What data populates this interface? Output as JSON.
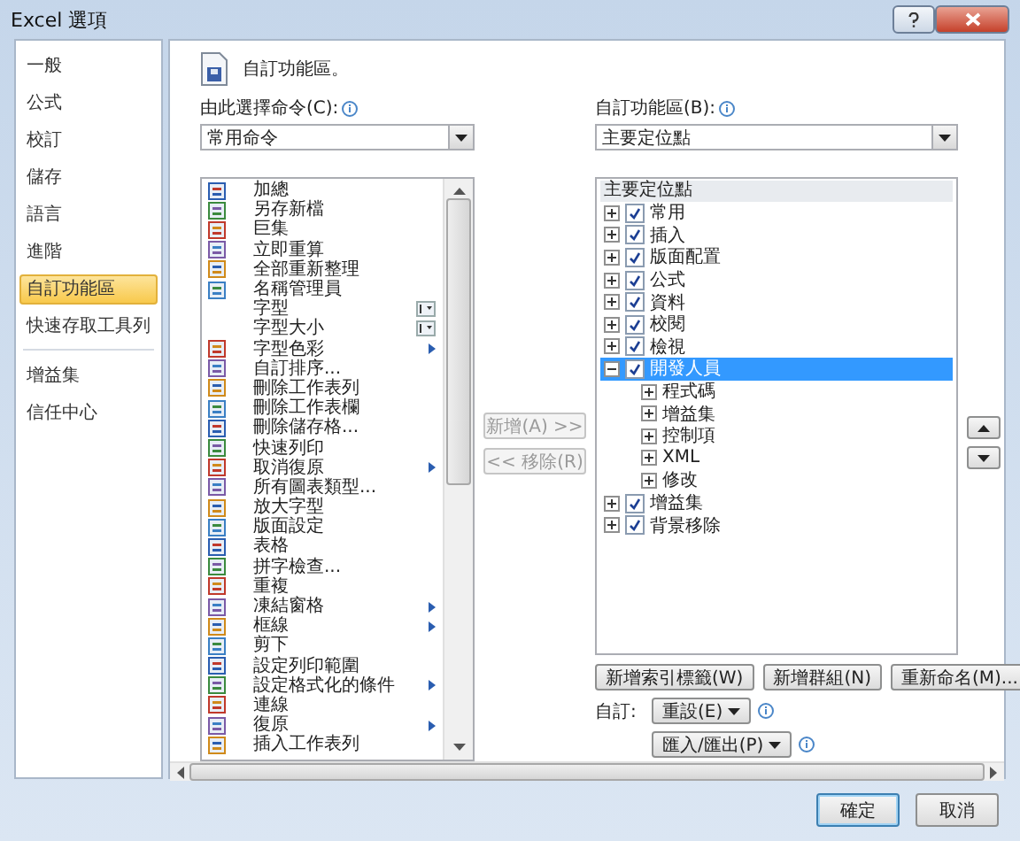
{
  "window": {
    "title": "Excel 選項"
  },
  "sidebar": {
    "groups": [
      {
        "items": [
          {
            "label": "一般",
            "selected": false
          },
          {
            "label": "公式",
            "selected": false
          },
          {
            "label": "校訂",
            "selected": false
          },
          {
            "label": "儲存",
            "selected": false
          },
          {
            "label": "語言",
            "selected": false
          },
          {
            "label": "進階",
            "selected": false
          },
          {
            "label": "自訂功能區",
            "selected": true
          },
          {
            "label": "快速存取工具列",
            "selected": false
          }
        ]
      },
      {
        "items": [
          {
            "label": "增益集",
            "selected": false
          },
          {
            "label": "信任中心",
            "selected": false
          }
        ]
      }
    ]
  },
  "header": {
    "title": "自訂功能區。"
  },
  "commands": {
    "label": "由此選擇命令(C):",
    "dropdown": "常用命令",
    "items": [
      {
        "label": "加總",
        "kind": "plain"
      },
      {
        "label": "另存新檔",
        "kind": "plain"
      },
      {
        "label": "巨集",
        "kind": "plain"
      },
      {
        "label": "立即重算",
        "kind": "plain"
      },
      {
        "label": "全部重新整理",
        "kind": "plain"
      },
      {
        "label": "名稱管理員",
        "kind": "plain"
      },
      {
        "label": "字型",
        "kind": "combo"
      },
      {
        "label": "字型大小",
        "kind": "combo"
      },
      {
        "label": "字型色彩",
        "kind": "submenu"
      },
      {
        "label": "自訂排序...",
        "kind": "plain"
      },
      {
        "label": "刪除工作表列",
        "kind": "plain"
      },
      {
        "label": "刪除工作表欄",
        "kind": "plain"
      },
      {
        "label": "刪除儲存格...",
        "kind": "plain"
      },
      {
        "label": "快速列印",
        "kind": "plain"
      },
      {
        "label": "取消復原",
        "kind": "submenu"
      },
      {
        "label": "所有圖表類型...",
        "kind": "plain"
      },
      {
        "label": "放大字型",
        "kind": "plain"
      },
      {
        "label": "版面設定",
        "kind": "plain"
      },
      {
        "label": "表格",
        "kind": "plain"
      },
      {
        "label": "拼字檢查...",
        "kind": "plain"
      },
      {
        "label": "重複",
        "kind": "plain"
      },
      {
        "label": "凍結窗格",
        "kind": "submenu"
      },
      {
        "label": "框線",
        "kind": "submenu"
      },
      {
        "label": "剪下",
        "kind": "plain"
      },
      {
        "label": "設定列印範圍",
        "kind": "plain"
      },
      {
        "label": "設定格式化的條件",
        "kind": "submenu"
      },
      {
        "label": "連線",
        "kind": "plain"
      },
      {
        "label": "復原",
        "kind": "submenu"
      },
      {
        "label": "插入工作表列",
        "kind": "plain"
      }
    ]
  },
  "transfer_buttons": [
    {
      "label": "新增(A) >>",
      "disabled": true
    },
    {
      "label": "<< 移除(R)",
      "disabled": true
    }
  ],
  "ribbon": {
    "label": "自訂功能區(B):",
    "dropdown": "主要定位點",
    "tree": {
      "header": "主要定位點",
      "items": [
        {
          "label": "常用",
          "checked": true,
          "expanded": false,
          "selected": false
        },
        {
          "label": "插入",
          "checked": true,
          "expanded": false,
          "selected": false
        },
        {
          "label": "版面配置",
          "checked": true,
          "expanded": false,
          "selected": false
        },
        {
          "label": "公式",
          "checked": true,
          "expanded": false,
          "selected": false
        },
        {
          "label": "資料",
          "checked": true,
          "expanded": false,
          "selected": false
        },
        {
          "label": "校閱",
          "checked": true,
          "expanded": false,
          "selected": false
        },
        {
          "label": "檢視",
          "checked": true,
          "expanded": false,
          "selected": false
        },
        {
          "label": "開發人員",
          "checked": true,
          "expanded": true,
          "selected": true,
          "children": [
            {
              "label": "程式碼",
              "expanded": false
            },
            {
              "label": "增益集",
              "expanded": false
            },
            {
              "label": "控制項",
              "expanded": false
            },
            {
              "label": "XML",
              "expanded": false
            },
            {
              "label": "修改",
              "expanded": false
            }
          ]
        },
        {
          "label": "增益集",
          "checked": true,
          "expanded": false,
          "selected": false
        },
        {
          "label": "背景移除",
          "checked": true,
          "expanded": false,
          "selected": false
        }
      ]
    },
    "buttons": [
      "新增索引標籤(W)",
      "新增群組(N)",
      "重新命名(M)..."
    ]
  },
  "customize": {
    "label": "自訂:",
    "reset": "重設(E)",
    "import_export": "匯入/匯出(P)"
  },
  "footer": {
    "buttons": [
      {
        "label": "確定",
        "default": true
      },
      {
        "label": "取消",
        "default": false
      }
    ]
  }
}
